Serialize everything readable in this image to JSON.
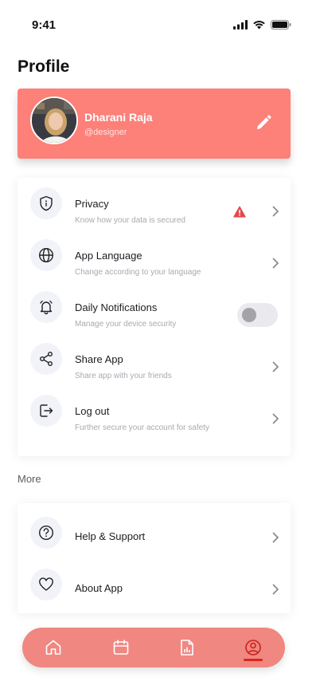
{
  "status_bar": {
    "time": "9:41",
    "icons": [
      "cellular-signal-icon",
      "wifi-icon",
      "battery-icon"
    ]
  },
  "header": {
    "title": "Profile"
  },
  "profile": {
    "name": "Dharani Raja",
    "handle": "@designer",
    "edit_icon": "pencil-icon",
    "card_color": "#fd8079"
  },
  "settings": {
    "items": [
      {
        "title": "Privacy",
        "subtitle": "Know how your data is secured",
        "icon": "shield-icon",
        "warning": true
      },
      {
        "title": "App Language",
        "subtitle": "Change according to your language",
        "icon": "globe-icon"
      },
      {
        "title": "Daily Notifications",
        "subtitle": "Manage your device security",
        "icon": "bell-icon",
        "toggle": false
      },
      {
        "title": "Share App",
        "subtitle": "Share app with your friends",
        "icon": "share-icon"
      },
      {
        "title": "Log out",
        "subtitle": "Further secure your account for safety",
        "icon": "logout-icon"
      }
    ]
  },
  "more": {
    "label": "More",
    "items": [
      {
        "title": "Help & Support",
        "icon": "question-icon"
      },
      {
        "title": "About App",
        "icon": "heart-icon"
      }
    ]
  },
  "bottom_nav": {
    "items": [
      "home-icon",
      "calendar-icon",
      "report-icon",
      "profile-icon"
    ],
    "active": "profile-icon",
    "color": "#f08781",
    "active_color": "#d9261f"
  },
  "colors": {
    "accent": "#fd8079",
    "warning": "#e5484d"
  }
}
